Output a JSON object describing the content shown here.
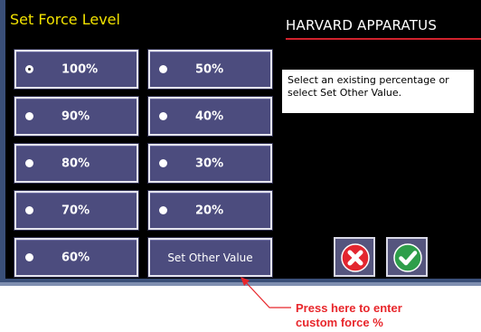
{
  "window": {
    "title": "Set Force Level",
    "brand": "HARVARD APPARATUS"
  },
  "options": {
    "left": [
      {
        "label": "100%",
        "selected": true
      },
      {
        "label": "90%",
        "selected": false
      },
      {
        "label": "80%",
        "selected": false
      },
      {
        "label": "70%",
        "selected": false
      },
      {
        "label": "60%",
        "selected": false
      }
    ],
    "right": [
      {
        "label": "50%",
        "selected": false
      },
      {
        "label": "40%",
        "selected": false
      },
      {
        "label": "30%",
        "selected": false
      },
      {
        "label": "20%",
        "selected": false
      }
    ],
    "other_label": "Set Other Value"
  },
  "info_text": "Select an existing percentage or select Set Other Value.",
  "actions": {
    "cancel_icon": "x-circle-icon",
    "confirm_icon": "check-circle-icon"
  },
  "callout": {
    "line1": "Press here to enter",
    "line2": "custom force %"
  },
  "colors": {
    "title": "#f2e200",
    "button_fill": "#4c4c7e",
    "brand_underline": "#d0222c",
    "cancel": "#e3262f",
    "confirm": "#2e9e4a",
    "callout": "#e8262b"
  }
}
